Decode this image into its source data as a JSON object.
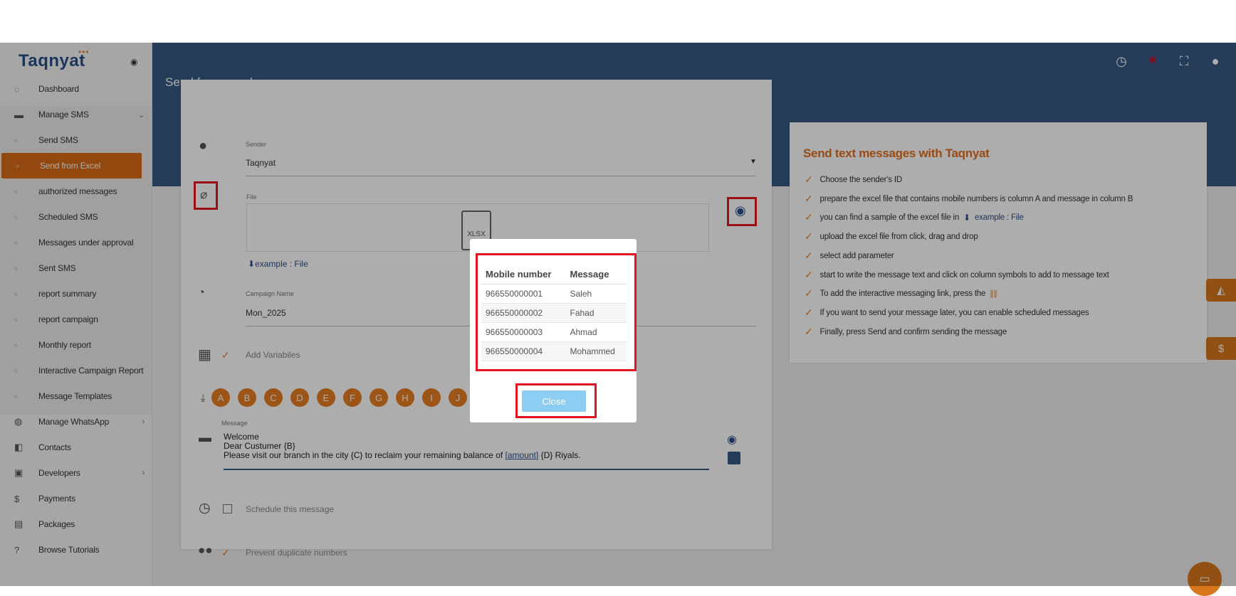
{
  "app": {
    "logo": "Taqnyat",
    "page_title": "Send from excel"
  },
  "topbar_icons": [
    "clock-icon",
    "uk-flag-icon",
    "fullscreen-icon",
    "user-account-icon"
  ],
  "sidebar": {
    "items": [
      {
        "label": "Dashboard",
        "icon": "dashboard-icon"
      },
      {
        "label": "Manage SMS",
        "icon": "sms-icon"
      },
      {
        "label": "Send SMS",
        "icon": "bullet"
      },
      {
        "label": "Send from Excel",
        "icon": "bullet"
      },
      {
        "label": "authorized messages",
        "icon": "bullet"
      },
      {
        "label": "Scheduled SMS",
        "icon": "bullet"
      },
      {
        "label": "Messages under approval",
        "icon": "bullet"
      },
      {
        "label": "Sent SMS",
        "icon": "bullet"
      },
      {
        "label": "report summary",
        "icon": "bullet"
      },
      {
        "label": "report campaign",
        "icon": "bullet"
      },
      {
        "label": "Monthly report",
        "icon": "bullet"
      },
      {
        "label": "Interactive Campaign Report",
        "icon": "bullet"
      },
      {
        "label": "Message Templates",
        "icon": "bullet"
      },
      {
        "label": "Manage WhatsApp",
        "icon": "whatsapp-icon"
      },
      {
        "label": "Contacts",
        "icon": "contacts-icon"
      },
      {
        "label": "Developers",
        "icon": "developers-icon"
      },
      {
        "label": "Payments",
        "icon": "dollar-icon"
      },
      {
        "label": "Packages",
        "icon": "packages-icon"
      },
      {
        "label": "Browse Tutorials",
        "icon": "help-icon"
      }
    ]
  },
  "form": {
    "sender_label": "Sender",
    "sender_value": "Taqnyat",
    "file_label": "File",
    "file_type": "XLSX",
    "example_link": "example : File",
    "campaign_label": "Campaign Name",
    "campaign_value": "Mon_2025",
    "add_variables": "Add Variabiles",
    "columns": [
      "A",
      "B",
      "C",
      "D",
      "E",
      "F",
      "G",
      "H",
      "I",
      "J"
    ],
    "message_label": "Message",
    "message_lines": [
      "Welcome",
      "Dear Custumer  {B}"
    ],
    "message_line3_prefix": "Please visit our branch in the city {C} to reclaim your remaining balance of ",
    "message_line3_link": "[amount]",
    "message_line3_suffix": "  {D} Riyals.",
    "schedule_label": "Schedule this message",
    "prevent_duplicates": "Prevent duplicate numbers"
  },
  "help_panel": {
    "title": "Send text messages with Taqnyat",
    "steps": [
      "Choose the sender's ID",
      "prepare the excel file that contains mobile numbers is column A and message in column B",
      "you can find a sample of the excel file in",
      "upload the excel file from click, drag and drop",
      "select add parameter",
      "start to write the message text and click on column symbols to add to message text",
      "To add the interactive messaging link, press the",
      "If you want to send your message later, you can enable scheduled messages",
      "Finally, press Send and confirm sending the message"
    ],
    "example_link": "example : File"
  },
  "modal": {
    "headers": [
      "Mobile number",
      "Message"
    ],
    "rows": [
      [
        "966550000001",
        "Saleh"
      ],
      [
        "966550000002",
        "Fahad"
      ],
      [
        "966550000003",
        "Ahmad"
      ],
      [
        "966550000004",
        "Mohammed"
      ]
    ],
    "close_label": "Close"
  },
  "colors": {
    "accent": "#d86a17",
    "header": "#385a85",
    "highlight": "#e3141f"
  }
}
